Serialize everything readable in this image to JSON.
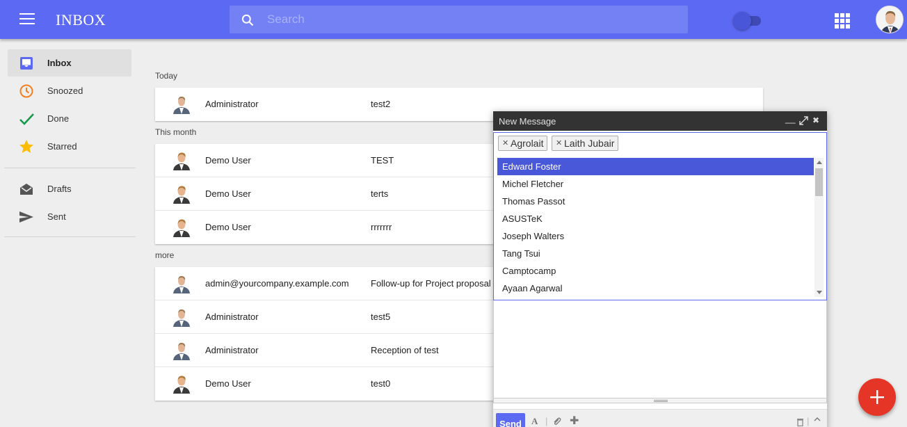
{
  "header": {
    "app_title": "INBOX",
    "search_placeholder": "Search",
    "accent": "#5c69f2"
  },
  "sidebar": {
    "items": [
      {
        "label": "Inbox",
        "icon": "inbox-icon",
        "active": true
      },
      {
        "label": "Snoozed",
        "icon": "clock-icon"
      },
      {
        "label": "Done",
        "icon": "check-icon"
      },
      {
        "label": "Starred",
        "icon": "star-icon"
      },
      {
        "label": "Drafts",
        "icon": "drafts-icon"
      },
      {
        "label": "Sent",
        "icon": "send-icon"
      }
    ]
  },
  "groups": [
    {
      "label": "Today",
      "rows": [
        {
          "sender": "Administrator",
          "subject": "test2"
        }
      ]
    },
    {
      "label": "This month",
      "rows": [
        {
          "sender": "Demo User",
          "subject": "TEST"
        },
        {
          "sender": "Demo User",
          "subject": "terts"
        },
        {
          "sender": "Demo User",
          "subject": "rrrrrrr"
        }
      ]
    },
    {
      "label": "more",
      "rows": [
        {
          "sender": "admin@yourcompany.example.com",
          "subject": "Follow-up for Project proposal"
        },
        {
          "sender": "Administrator",
          "subject": "test5"
        },
        {
          "sender": "Administrator",
          "subject": "Reception of test"
        },
        {
          "sender": "Demo User",
          "subject": "test0"
        }
      ]
    }
  ],
  "compose": {
    "title": "New Message",
    "minimize": "__",
    "close": "✖",
    "recipients": [
      "Agrolait",
      "Laith Jubair"
    ],
    "suggestions": [
      "Edward Foster",
      "Michel Fletcher",
      "Thomas Passot",
      "ASUSTeK",
      "Joseph Walters",
      "Tang Tsui",
      "Camptocamp",
      "Ayaan Agarwal"
    ],
    "send_label": "Send"
  }
}
